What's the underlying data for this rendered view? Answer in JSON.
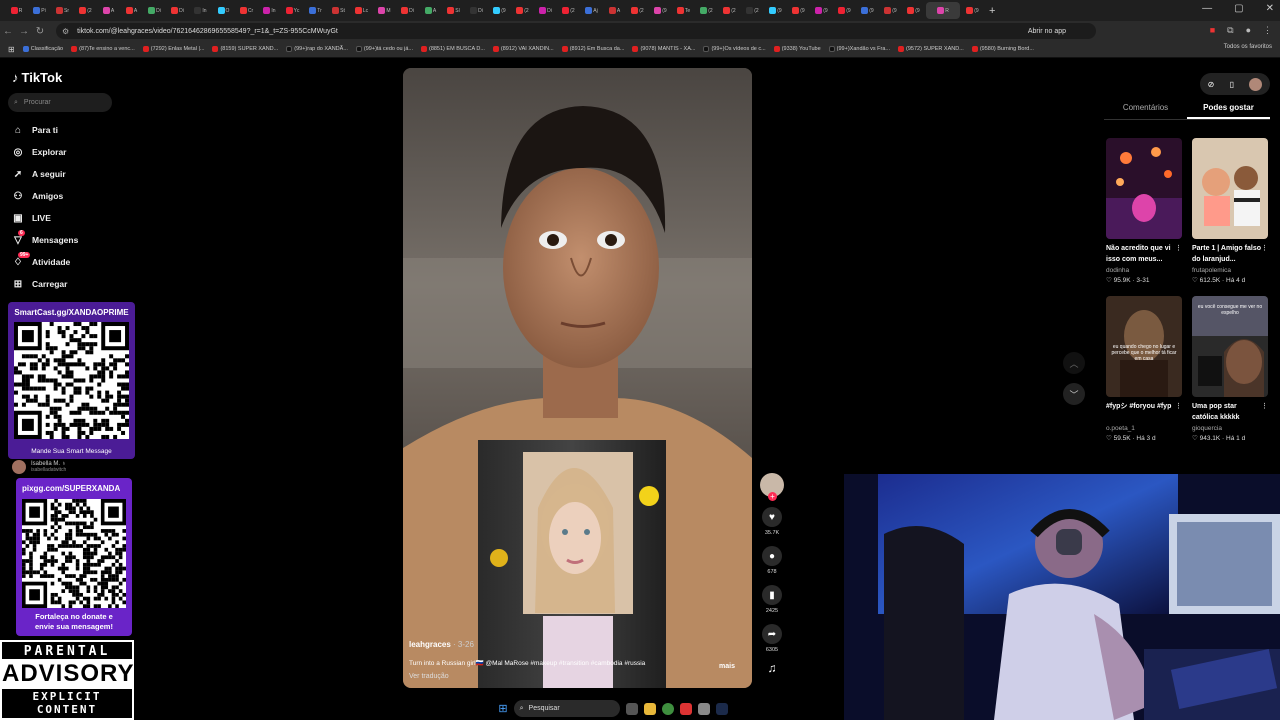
{
  "browser": {
    "tabs": [
      "R",
      "Pi",
      "Sr",
      "(2",
      "A",
      "A",
      "Di",
      "Di",
      "In",
      "O",
      "Cr",
      "In",
      "Yc",
      "Tr",
      "St",
      "Lc",
      "M",
      "Di",
      "A",
      "Sl",
      "Di",
      "(9",
      "(2",
      "Di",
      "(2",
      "Aj",
      "A",
      "(2",
      "(9",
      "Te",
      "(2",
      "(2",
      "(2",
      "(9",
      "(9",
      "(9",
      "(9",
      "(9",
      "(9",
      "(9",
      "R",
      "(9"
    ],
    "active_tab": "R",
    "url": "tiktok.com/@leahgraces/video/7621646286965558549?_r=1&_t=ZS-955CcMWuyGt",
    "open_app_label": "Abrir no app",
    "bookmarks": [
      "Classificação",
      "(87)Te ensino a venc...",
      "(7292) Enlas Metal |...",
      "(8159) SUPER XAND...",
      "(99+)rap do XANDÃ...",
      "(99+)tá cedo ou já...",
      "(8851) EM BUSCA D...",
      "(8912) VAI XANDIN...",
      "(8912) Em Busca da...",
      "(9078) MANTIS - XA...",
      "(99+)Os vídeos de c...",
      "(9338) YouTube",
      "(99+)Xandão vs Fra...",
      "(9572) SUPER XAND...",
      "(9580) Burning Bord..."
    ],
    "all_favorites_label": "Todos os favoritos"
  },
  "tiktok": {
    "logo": "TikTok",
    "search_placeholder": "Procurar",
    "nav": [
      {
        "icon": "home-icon",
        "glyph": "⌂",
        "label": "Para ti"
      },
      {
        "icon": "compass-icon",
        "glyph": "◎",
        "label": "Explorar"
      },
      {
        "icon": "following-icon",
        "glyph": "➚",
        "label": "A seguir"
      },
      {
        "icon": "friends-icon",
        "glyph": "⚇",
        "label": "Amigos"
      },
      {
        "icon": "live-icon",
        "glyph": "▣",
        "label": "LIVE"
      },
      {
        "icon": "messages-icon",
        "glyph": "▽",
        "label": "Mensagens",
        "badge": "6"
      },
      {
        "icon": "activity-icon",
        "glyph": "♢",
        "label": "Atividade",
        "badge": "99+"
      },
      {
        "icon": "upload-icon",
        "glyph": "⊞",
        "label": "Carregar"
      }
    ]
  },
  "overlay": {
    "qr1_title": "SmartCast.gg/XANDAOPRIME",
    "qr1_caption": "Mande Sua Smart Message",
    "suggested_user": "Isabella M. ♁",
    "suggested_handle": "isabelladatwitch",
    "qr2_title": "pixgg.com/SUPERXANDA",
    "qr2_caption_1": "Fortaleça no donate e",
    "qr2_caption_2": "envie sua mensagem!",
    "advisory_1": "PARENTAL",
    "advisory_2": "ADVISORY",
    "advisory_3": "EXPLICIT CONTENT"
  },
  "video": {
    "author": "leahgraces",
    "date": "· 3-26",
    "description": "Turn into a Russian girl🇷🇺 @Mal MaRose #makeup #transition #cambodia #russia",
    "more_label": "mais",
    "translate_label": "Ver tradução",
    "likes": "35.7K",
    "comments": "678",
    "saves": "2425",
    "shares": "6305"
  },
  "panel": {
    "tab_comments": "Comentários",
    "tab_suggested": "Podes gostar",
    "cards": [
      {
        "title": "Não acredito que vi isso com meus...",
        "user": "dodinha",
        "likes": "95.9K",
        "age": "3-31"
      },
      {
        "title": "Parte 1 | Amigo falso do laranjud...",
        "user": "frutapolemica",
        "likes": "612.5K",
        "age": "Há 4 d"
      },
      {
        "title": "#fypシ #foryou #fyp",
        "user": "o.poeta_1",
        "likes": "59.5K",
        "age": "Há 3 d"
      },
      {
        "title": "Uma pop star católica kkkkk",
        "user": "gioquercia",
        "likes": "943.1K",
        "age": "Há 1 d"
      }
    ],
    "card3_overlay": "eu quando chego no lugar e percebe que o melhor tá ficar em casa",
    "card4_overlay": "eu você consegue me ver no espelho"
  },
  "taskbar": {
    "search_label": "Pesquisar"
  },
  "colors": {
    "tiktok_red": "#fe2c55",
    "qr1_bg": "#4b1c96",
    "qr2_bg": "#6a24c8"
  }
}
